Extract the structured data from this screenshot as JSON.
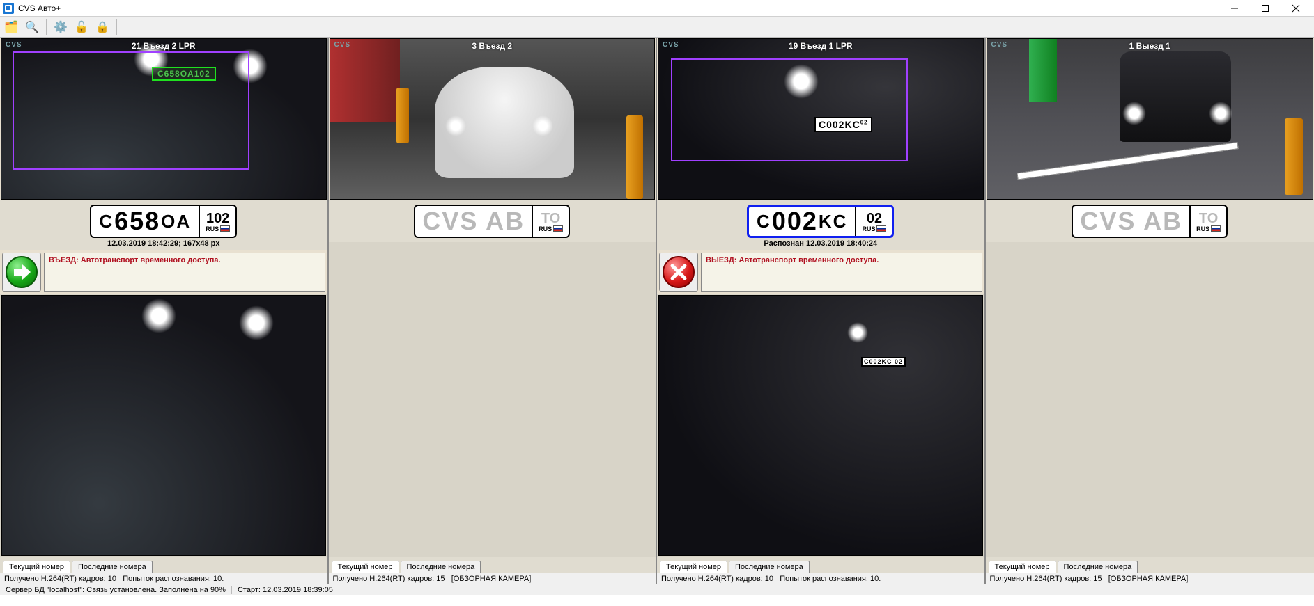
{
  "app": {
    "title": "CVS Авто+"
  },
  "toolbar": {
    "tools_icon": "🗂️",
    "search_icon": "🔍",
    "gear_icon": "⚙️",
    "unlock_icon": "🔓",
    "lock_icon": "🔒"
  },
  "columns": [
    {
      "camera": {
        "title": "21 Въезд 2 LPR",
        "cvs": "CVS",
        "plate_text": "C658OA102"
      },
      "plate": {
        "main_letters_a": "C",
        "main_digits": "658",
        "main_letters_b": "OA",
        "region": "102",
        "country": "RUS"
      },
      "caption": "12.03.2019 18:42:29; 167x48 px",
      "status": {
        "kind": "allow",
        "message": "ВЪЕЗД: Автотранспорт временного доступа."
      },
      "has_snapshot": true,
      "tabs": {
        "current": "Текущий номер",
        "last": "Последние номера",
        "active": 0
      },
      "colstatus": {
        "frames": "Получено H.264(RT) кадров: 10",
        "attempts": "Попыток распознавания: 10."
      }
    },
    {
      "camera": {
        "title": "3 Въезд 2",
        "cvs": "CVS"
      },
      "plate": {
        "main_placeholder": "CVS AB",
        "region_placeholder": "TO",
        "country": "RUS"
      },
      "caption": "",
      "has_status": false,
      "has_snapshot": false,
      "tabs": {
        "current": "Текущий номер",
        "last": "Последние номера",
        "active": 0
      },
      "colstatus": {
        "frames": "Получено H.264(RT) кадров: 15",
        "note": "[ОБЗОРНАЯ КАМЕРА]"
      }
    },
    {
      "camera": {
        "title": "19 Въезд 1 LPR",
        "cvs": "CVS",
        "bright_plate": "C002KC",
        "bright_region": "02"
      },
      "plate": {
        "main_letters_a": "C",
        "main_digits": "002",
        "main_letters_b": "KC",
        "region": "02",
        "country": "RUS",
        "blue": true
      },
      "caption": "Распознан 12.03.2019 18:40:24",
      "status": {
        "kind": "deny",
        "message": "ВЫЕЗД: Автотранспорт временного доступа."
      },
      "has_snapshot": true,
      "snap_plate": "C002KC 02",
      "tabs": {
        "current": "Текущий номер",
        "last": "Последние номера",
        "active": 0
      },
      "colstatus": {
        "frames": "Получено H.264(RT) кадров: 10",
        "attempts": "Попыток распознавания: 10."
      }
    },
    {
      "camera": {
        "title": "1 Выезд 1",
        "cvs": "CVS"
      },
      "plate": {
        "main_placeholder": "CVS AB",
        "region_placeholder": "TO",
        "country": "RUS"
      },
      "caption": "",
      "has_status": false,
      "has_snapshot": false,
      "tabs": {
        "current": "Текущий номер",
        "last": "Последние номера",
        "active": 0
      },
      "colstatus": {
        "frames": "Получено H.264(RT) кадров: 15",
        "note": "[ОБЗОРНАЯ КАМЕРА]"
      }
    }
  ],
  "footer": {
    "server": "Сервер БД \"localhost\": Связь установлена. Заполнена на 90%",
    "start": "Старт: 12.03.2019 18:39:05"
  }
}
